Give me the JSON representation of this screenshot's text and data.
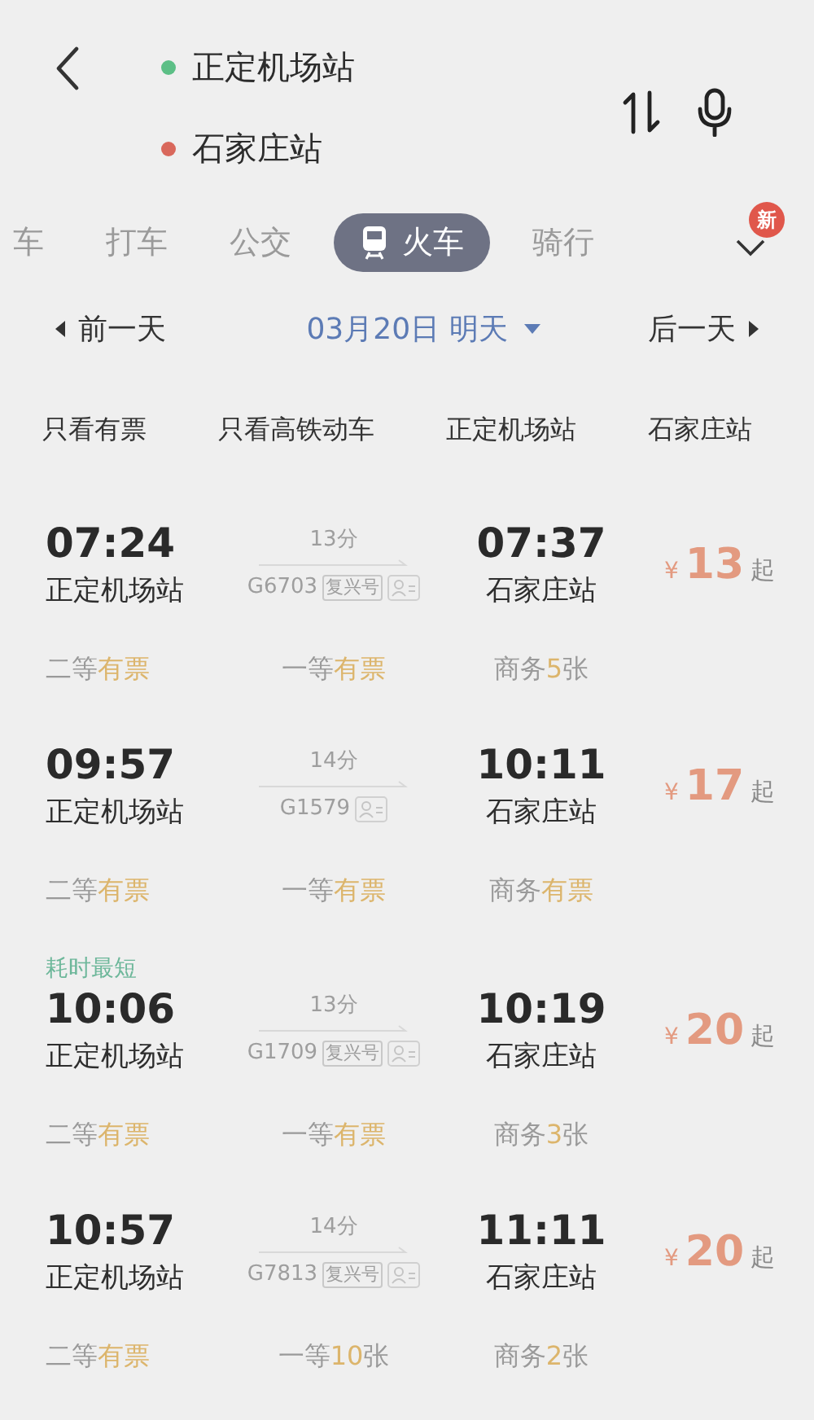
{
  "route": {
    "origin": {
      "name": "正定机场站",
      "color": "#5cbf86"
    },
    "destination": {
      "name": "石家庄站",
      "color": "#d9685c"
    }
  },
  "tabs": [
    {
      "label": "车",
      "selected": false
    },
    {
      "label": "打车",
      "selected": false
    },
    {
      "label": "公交",
      "selected": false
    },
    {
      "label": "火车",
      "selected": true
    },
    {
      "label": "骑行",
      "selected": false
    }
  ],
  "more_badge": "新",
  "date_bar": {
    "prev": "前一天",
    "date": "03月20日 明天",
    "next": "后一天"
  },
  "filters": [
    "只看有票",
    "只看高铁动车",
    "正定机场站",
    "石家庄站"
  ],
  "trains": [
    {
      "depart_time": "07:24",
      "depart_station": "正定机场站",
      "duration": "13分",
      "train_no": "G6703",
      "type_tag": "复兴号",
      "arrive_time": "07:37",
      "arrive_station": "石家庄站",
      "currency": "¥",
      "price": "13",
      "price_suffix": "起",
      "seats": [
        {
          "class": "二等",
          "avail": "有票"
        },
        {
          "class": "一等",
          "avail": "有票"
        },
        {
          "class": "商务",
          "avail": "5",
          "unit": "张"
        }
      ]
    },
    {
      "depart_time": "09:57",
      "depart_station": "正定机场站",
      "duration": "14分",
      "train_no": "G1579",
      "arrive_time": "10:11",
      "arrive_station": "石家庄站",
      "currency": "¥",
      "price": "17",
      "price_suffix": "起",
      "seats": [
        {
          "class": "二等",
          "avail": "有票"
        },
        {
          "class": "一等",
          "avail": "有票"
        },
        {
          "class": "商务",
          "avail": "有票"
        }
      ]
    },
    {
      "tag": "耗时最短",
      "depart_time": "10:06",
      "depart_station": "正定机场站",
      "duration": "13分",
      "train_no": "G1709",
      "type_tag": "复兴号",
      "arrive_time": "10:19",
      "arrive_station": "石家庄站",
      "currency": "¥",
      "price": "20",
      "price_suffix": "起",
      "seats": [
        {
          "class": "二等",
          "avail": "有票"
        },
        {
          "class": "一等",
          "avail": "有票"
        },
        {
          "class": "商务",
          "avail": "3",
          "unit": "张"
        }
      ]
    },
    {
      "depart_time": "10:57",
      "depart_station": "正定机场站",
      "duration": "14分",
      "train_no": "G7813",
      "type_tag": "复兴号",
      "arrive_time": "11:11",
      "arrive_station": "石家庄站",
      "currency": "¥",
      "price": "20",
      "price_suffix": "起",
      "seats": [
        {
          "class": "二等",
          "avail": "有票"
        },
        {
          "class": "一等",
          "avail": "10",
          "unit": "张"
        },
        {
          "class": "商务",
          "avail": "2",
          "unit": "张"
        }
      ]
    }
  ]
}
